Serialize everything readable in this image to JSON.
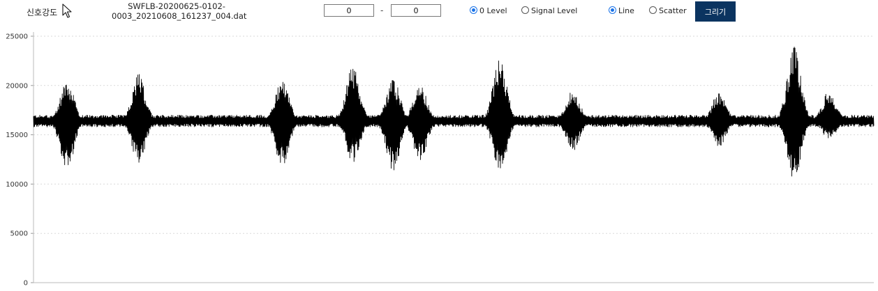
{
  "toolbar": {
    "title": "신호강도",
    "filename_line1": "SWFLB-20200625-0102-",
    "filename_line2": "0003_20210608_161237_004.dat",
    "range_start_value": "0",
    "range_separator": "-",
    "range_end_value": "0",
    "level_options": [
      {
        "label": "0 Level",
        "selected": true
      },
      {
        "label": "Signal Level",
        "selected": false
      }
    ],
    "plot_options": [
      {
        "label": "Line",
        "selected": true
      },
      {
        "label": "Scatter",
        "selected": false
      }
    ],
    "draw_label": "그리기",
    "icons": [
      "cursor-arrow-icon"
    ]
  },
  "colors": {
    "accent": "#1a73e8",
    "button_bg": "#0b3460",
    "signal": "#000000",
    "gridline": "#d9d9d9"
  },
  "chart_data": {
    "type": "line",
    "title": "",
    "xlabel": "",
    "ylabel": "",
    "ylim": [
      0,
      25000
    ],
    "yticks": [
      "25000",
      "20000",
      "15000",
      "10000",
      "5000",
      "0"
    ],
    "grid": "horizontal-dotted",
    "legend": "none",
    "series": [
      {
        "baseline": 16400,
        "noise_amplitude": 600,
        "bursts": [
          {
            "x": 0.04,
            "min": 11400,
            "max": 20500
          },
          {
            "x": 0.125,
            "min": 12000,
            "max": 21200
          },
          {
            "x": 0.296,
            "min": 11700,
            "max": 20800
          },
          {
            "x": 0.38,
            "min": 12200,
            "max": 22000
          },
          {
            "x": 0.428,
            "min": 11300,
            "max": 20700
          },
          {
            "x": 0.46,
            "min": 12300,
            "max": 20200
          },
          {
            "x": 0.555,
            "min": 11100,
            "max": 22800
          },
          {
            "x": 0.642,
            "min": 13400,
            "max": 19500
          },
          {
            "x": 0.816,
            "min": 13800,
            "max": 19400
          },
          {
            "x": 0.905,
            "min": 10300,
            "max": 24200
          },
          {
            "x": 0.947,
            "min": 14500,
            "max": 19500
          }
        ]
      }
    ]
  }
}
